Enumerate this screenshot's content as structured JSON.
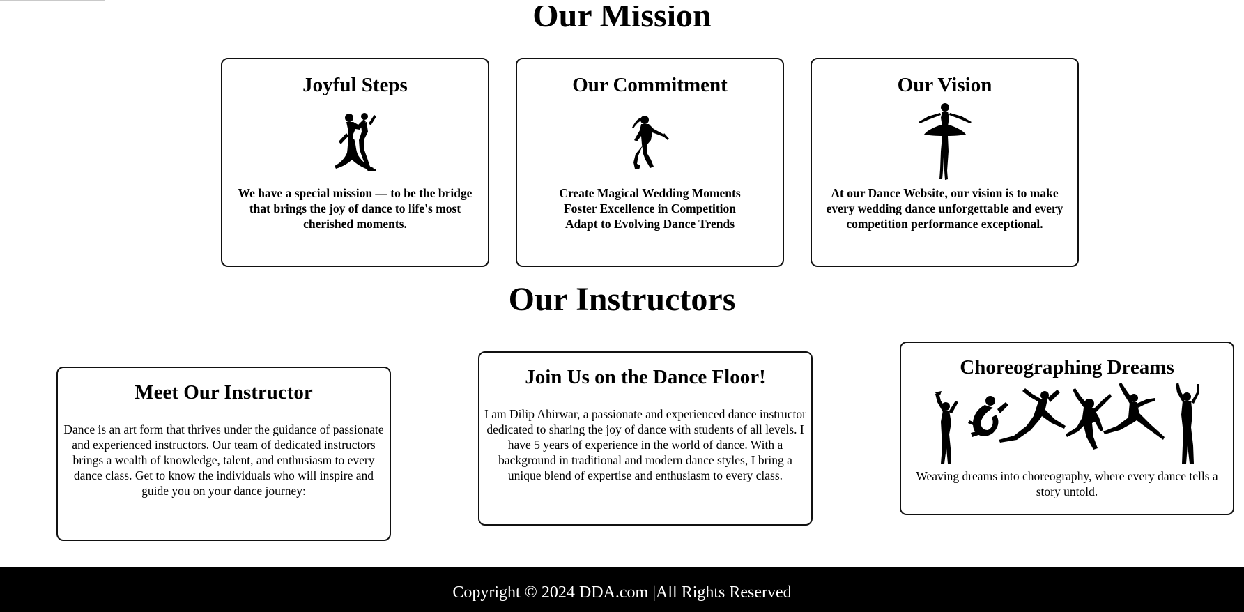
{
  "mission": {
    "title": "Our Mission",
    "cards": [
      {
        "title": "Joyful Steps",
        "icon": "couple-dancers-silhouette",
        "lines": [
          "We have a special mission — to be the bridge",
          "that brings the joy of dance to life's most",
          "cherished moments."
        ]
      },
      {
        "title": "Our Commitment",
        "icon": "jumping-dancer-silhouette",
        "lines": [
          "Create Magical Wedding Moments",
          "Foster Excellence in Competition",
          "Adapt to Evolving Dance Trends"
        ]
      },
      {
        "title": "Our Vision",
        "icon": "ballerina-silhouette",
        "lines": [
          "At our Dance Website, our vision is to make",
          "every wedding dance unforgettable and every",
          "competition performance exceptional."
        ]
      }
    ]
  },
  "instructors": {
    "title": "Our Instructors",
    "cards": [
      {
        "title": "Meet Our Instructor",
        "text": "Dance is an art form that thrives under the guidance of passionate and experienced instructors. Our team of dedicated instructors brings a wealth of knowledge, talent, and enthusiasm to every dance class. Get to know the individuals who will inspire and guide you on your dance journey:"
      },
      {
        "title": "Join Us on the Dance Floor!",
        "text": "I am Dilip Ahirwar, a passionate and experienced dance instructor dedicated to sharing the joy of dance with students of all levels. I have 5 years of experience in the world of dance. With a background in traditional and modern dance styles, I bring a unique blend of expertise and enthusiasm to every class."
      },
      {
        "title": "Choreographing Dreams",
        "icon": "dancers-group-silhouette",
        "text": "Weaving dreams into choreography, where every dance tells a story untold."
      }
    ]
  },
  "footer": {
    "text": "Copyright © 2024 DDA.com |All Rights Reserved"
  },
  "colors": {
    "background": "#ffffff",
    "footer_background": "#000000",
    "footer_text": "#ffffff",
    "card_border": "#111111"
  }
}
